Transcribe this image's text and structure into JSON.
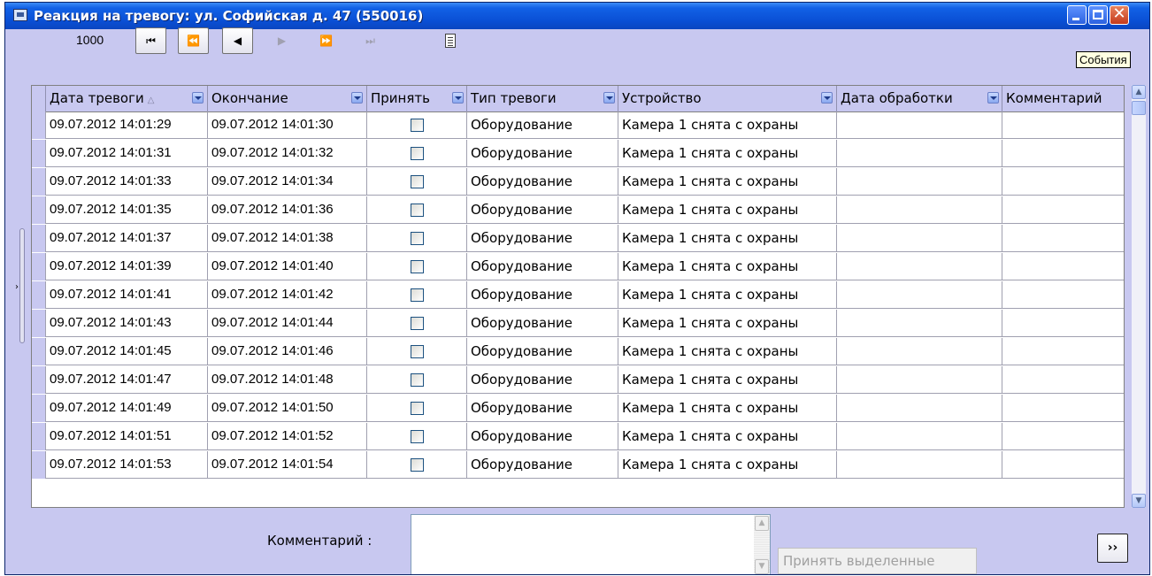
{
  "window": {
    "title": "Реакция на тревогу: ул. Софийская д. 47 (550016)",
    "close_glyph": "✕"
  },
  "toolbar": {
    "record_count": "1000",
    "nav_buttons": [
      {
        "glyph": "⏮",
        "enabled": true
      },
      {
        "glyph": "⏪",
        "enabled": true
      },
      {
        "glyph": "◀",
        "enabled": true
      },
      {
        "glyph": "▶",
        "enabled": false
      },
      {
        "glyph": "⏩",
        "enabled": false
      },
      {
        "glyph": "⏭",
        "enabled": false
      }
    ],
    "columns_icon": "column-chooser-icon",
    "tooltip": "События"
  },
  "grid": {
    "columns": [
      "Дата тревоги",
      "Окончание",
      "Принять",
      "Тип тревоги",
      "Устройство",
      "Дата обработки",
      "Комментарий"
    ],
    "sort_glyph": "△",
    "rows": [
      {
        "start": "09.07.2012 14:01:29",
        "end": "09.07.2012 14:01:30",
        "accepted": false,
        "type": "Оборудование",
        "device": "Камера 1 снята с охраны",
        "processed": "",
        "comment": ""
      },
      {
        "start": "09.07.2012 14:01:31",
        "end": "09.07.2012 14:01:32",
        "accepted": false,
        "type": "Оборудование",
        "device": "Камера 1 снята с охраны",
        "processed": "",
        "comment": ""
      },
      {
        "start": "09.07.2012 14:01:33",
        "end": "09.07.2012 14:01:34",
        "accepted": false,
        "type": "Оборудование",
        "device": "Камера 1 снята с охраны",
        "processed": "",
        "comment": ""
      },
      {
        "start": "09.07.2012 14:01:35",
        "end": "09.07.2012 14:01:36",
        "accepted": false,
        "type": "Оборудование",
        "device": "Камера 1 снята с охраны",
        "processed": "",
        "comment": ""
      },
      {
        "start": "09.07.2012 14:01:37",
        "end": "09.07.2012 14:01:38",
        "accepted": false,
        "type": "Оборудование",
        "device": "Камера 1 снята с охраны",
        "processed": "",
        "comment": ""
      },
      {
        "start": "09.07.2012 14:01:39",
        "end": "09.07.2012 14:01:40",
        "accepted": false,
        "type": "Оборудование",
        "device": "Камера 1 снята с охраны",
        "processed": "",
        "comment": ""
      },
      {
        "start": "09.07.2012 14:01:41",
        "end": "09.07.2012 14:01:42",
        "accepted": false,
        "type": "Оборудование",
        "device": "Камера 1 снята с охраны",
        "processed": "",
        "comment": ""
      },
      {
        "start": "09.07.2012 14:01:43",
        "end": "09.07.2012 14:01:44",
        "accepted": false,
        "type": "Оборудование",
        "device": "Камера 1 снята с охраны",
        "processed": "",
        "comment": ""
      },
      {
        "start": "09.07.2012 14:01:45",
        "end": "09.07.2012 14:01:46",
        "accepted": false,
        "type": "Оборудование",
        "device": "Камера 1 снята с охраны",
        "processed": "",
        "comment": ""
      },
      {
        "start": "09.07.2012 14:01:47",
        "end": "09.07.2012 14:01:48",
        "accepted": false,
        "type": "Оборудование",
        "device": "Камера 1 снята с охраны",
        "processed": "",
        "comment": ""
      },
      {
        "start": "09.07.2012 14:01:49",
        "end": "09.07.2012 14:01:50",
        "accepted": false,
        "type": "Оборудование",
        "device": "Камера 1 снята с охраны",
        "processed": "",
        "comment": ""
      },
      {
        "start": "09.07.2012 14:01:51",
        "end": "09.07.2012 14:01:52",
        "accepted": false,
        "type": "Оборудование",
        "device": "Камера 1 снята с охраны",
        "processed": "",
        "comment": ""
      },
      {
        "start": "09.07.2012 14:01:53",
        "end": "09.07.2012 14:01:54",
        "accepted": false,
        "type": "Оборудование",
        "device": "Камера 1 снята с охраны",
        "processed": "",
        "comment": ""
      }
    ]
  },
  "footer": {
    "comment_label": "Комментарий :",
    "comment_value": "",
    "accept_button": "Принять выделенные",
    "expand_button": "››"
  },
  "colors": {
    "window_bg": "#c8c8f0",
    "title_bar": "#0a4fd4",
    "close_button": "#c63a1c"
  }
}
